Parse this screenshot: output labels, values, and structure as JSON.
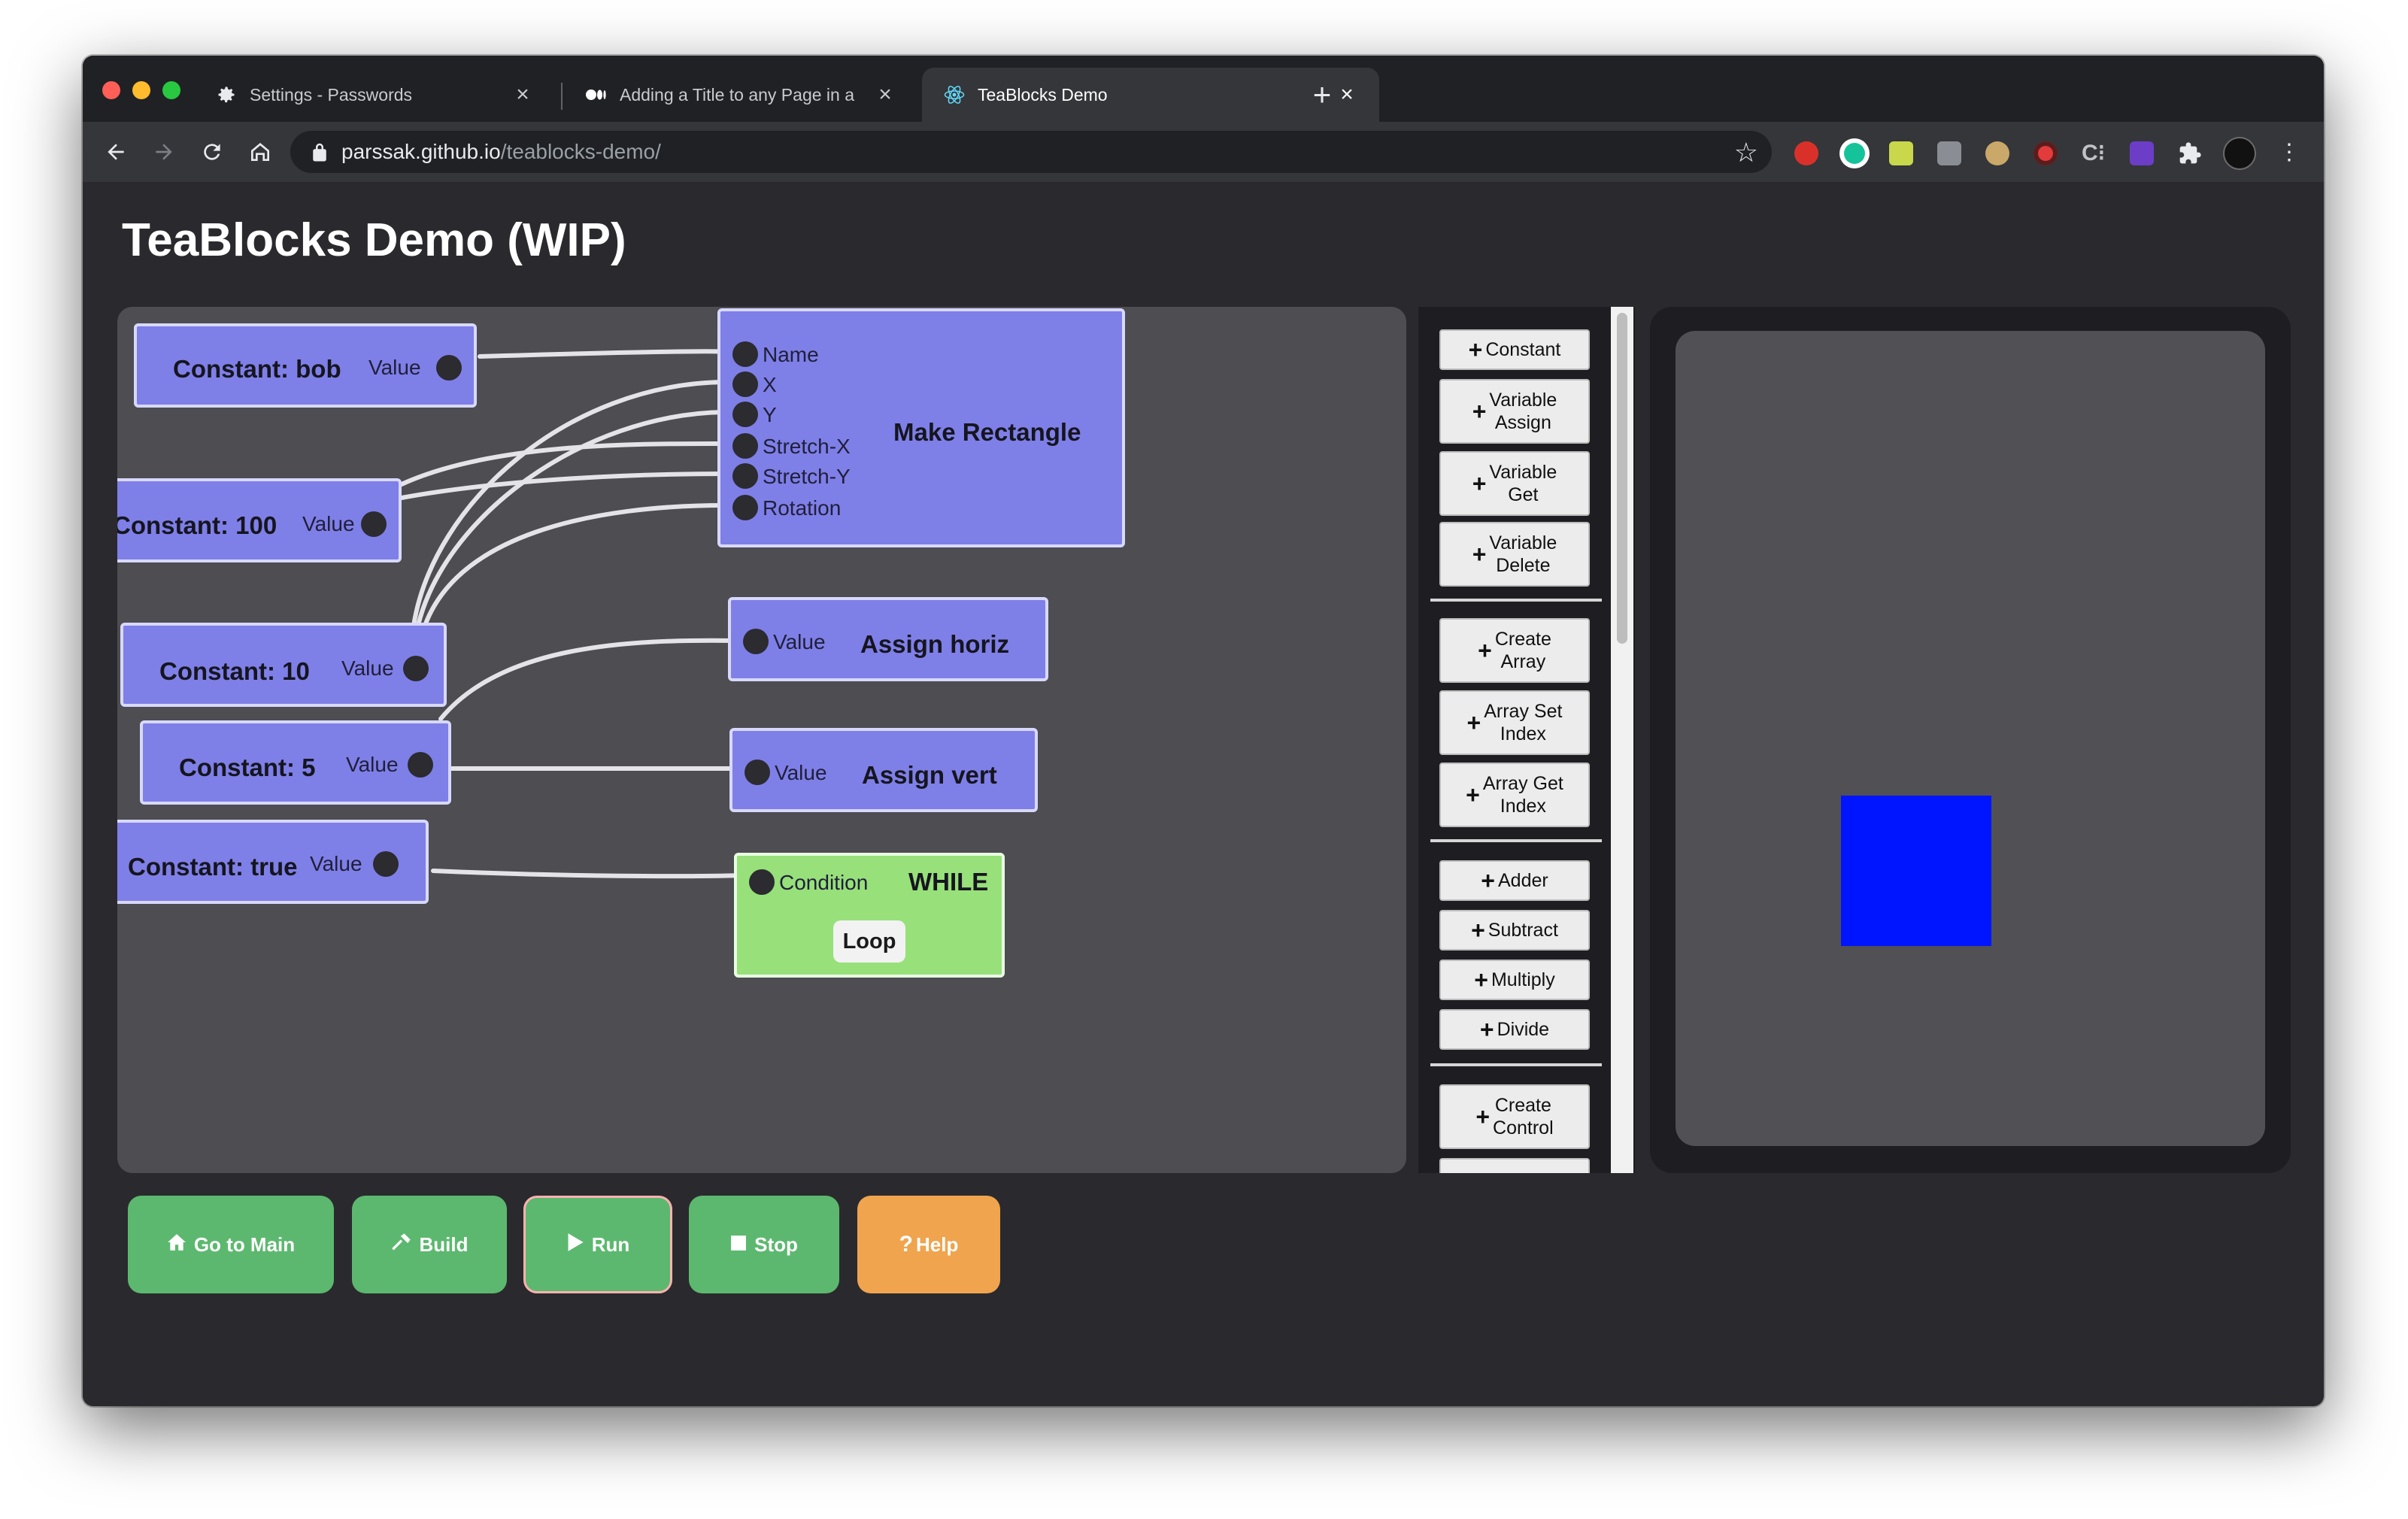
{
  "browser": {
    "tabs": [
      {
        "title": "Settings - Passwords",
        "favicon": "gear-icon"
      },
      {
        "title": "Adding a Title to any Page in a",
        "favicon": "medium-icon"
      },
      {
        "title": "TeaBlocks Demo",
        "favicon": "react-icon"
      }
    ],
    "url_host": "parssak.github.io",
    "url_path": "/teablocks-demo/",
    "traffic_colors": [
      "#ff5f57",
      "#febc2e",
      "#28c840"
    ]
  },
  "page": {
    "title": "TeaBlocks Demo (WIP)"
  },
  "nodes": {
    "const_bob": {
      "label": "Constant: bob",
      "port": "Value"
    },
    "const_100": {
      "label": "Constant: 100",
      "port": "Value"
    },
    "const_10": {
      "label": "Constant: 10",
      "port": "Value"
    },
    "const_5": {
      "label": "Constant: 5",
      "port": "Value"
    },
    "const_true": {
      "label": "Constant: true",
      "port": "Value"
    },
    "make_rect": {
      "label": "Make Rectangle",
      "ports": [
        "Name",
        "X",
        "Y",
        "Stretch-X",
        "Stretch-Y",
        "Rotation"
      ]
    },
    "assign_horiz": {
      "label": "Assign horiz",
      "port": "Value"
    },
    "assign_vert": {
      "label": "Assign vert",
      "port": "Value"
    },
    "while_node": {
      "label": "WHILE",
      "port": "Condition",
      "loop": "Loop"
    }
  },
  "palette": {
    "constant": "Constant",
    "variable_assign": [
      "Variable",
      "Assign"
    ],
    "variable_get": [
      "Variable",
      "Get"
    ],
    "variable_delete": [
      "Variable",
      "Delete"
    ],
    "create_array": [
      "Create",
      "Array"
    ],
    "array_set_index": [
      "Array Set",
      "Index"
    ],
    "array_get_index": [
      "Array Get",
      "Index"
    ],
    "adder": "Adder",
    "subtract": "Subtract",
    "multiply": "Multiply",
    "divide": "Divide",
    "create_control": [
      "Create",
      "Control"
    ]
  },
  "canvas": {
    "rect_color": "#0015ff"
  },
  "actions": {
    "go_main": "Go to Main",
    "build": "Build",
    "run": "Run",
    "stop": "Stop",
    "help": "Help"
  },
  "colors": {
    "node_blue": "#7f7fe8",
    "node_green": "#97e07a",
    "action_green": "#5db86f",
    "help_orange": "#f0a44e"
  }
}
